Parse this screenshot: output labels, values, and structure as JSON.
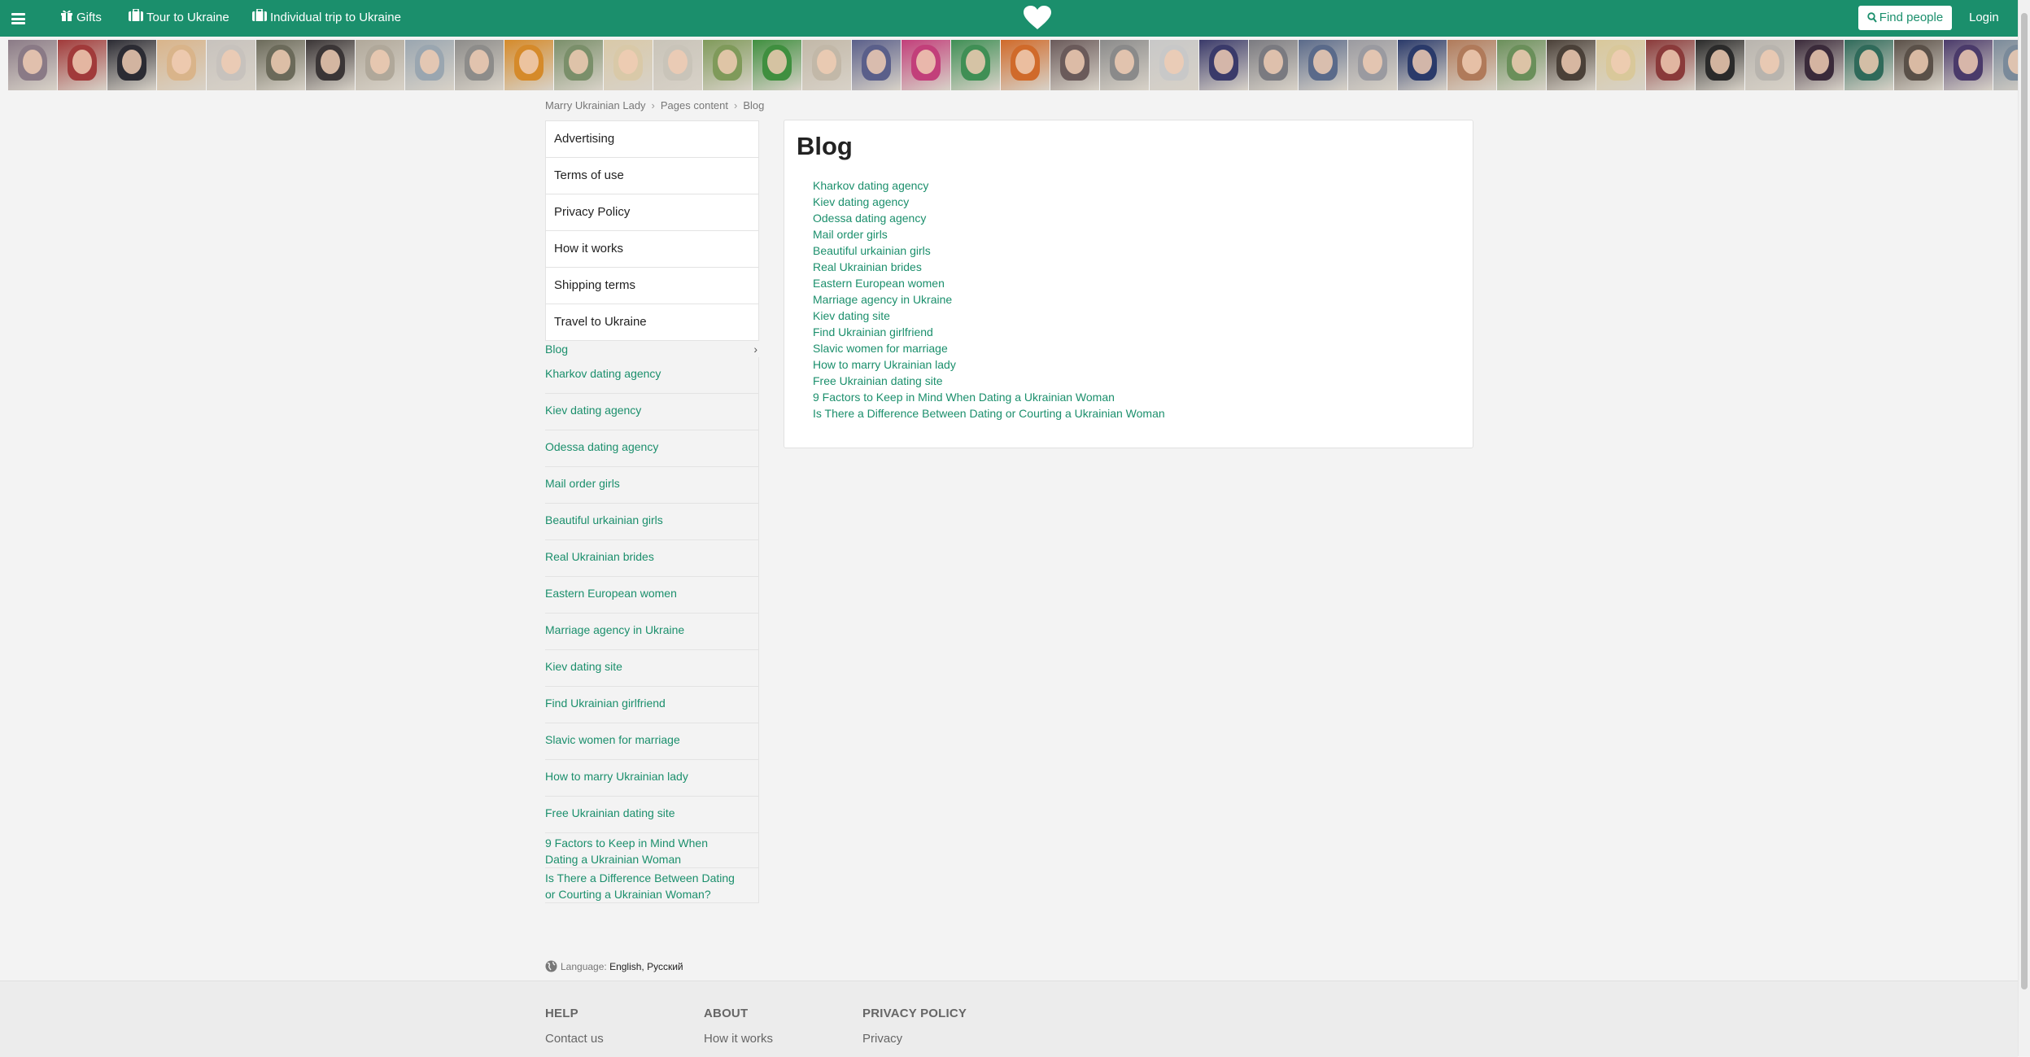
{
  "nav": {
    "gifts": "Gifts",
    "tour": "Tour to Ukraine",
    "individual_trip": "Individual trip to Ukraine",
    "find_people": "Find people",
    "login": "Login"
  },
  "photo_strip": {
    "count": 41,
    "colors": [
      "#8a7a86",
      "#a13a3a",
      "#2b2b33",
      "#d9b48a",
      "#c7c2bd",
      "#6b6a5a",
      "#3a3536",
      "#b0a89a",
      "#9aa6b0",
      "#8d8c8a",
      "#d58a2a",
      "#7a8f6a",
      "#d9c9a8",
      "#c9c4b9",
      "#7f9a5a",
      "#3f8f3f",
      "#c2b8a8",
      "#5a5f8a",
      "#c23f7a",
      "#3f8f55",
      "#d06a2a",
      "#6a5a5a",
      "#8a8a8a",
      "#c8c8c8",
      "#3a3a6a",
      "#7a7a80",
      "#5a6a8a",
      "#9a9aa0",
      "#2a3a6a",
      "#b07a5a",
      "#6a8f5a",
      "#4a4038",
      "#d9c89a",
      "#8a3a3a",
      "#2a2a2a",
      "#b8b4ae",
      "#3a2a3a",
      "#2f6a5a",
      "#5a5048",
      "#4a3a6a",
      "#7a8a9a"
    ]
  },
  "breadcrumb": [
    "Marry Ukrainian Lady",
    "Pages content",
    "Blog"
  ],
  "sidebar": {
    "boxed": [
      "Advertising",
      "Terms of use",
      "Privacy Policy",
      "How it works",
      "Shipping terms",
      "Travel to Ukraine"
    ],
    "blog_label": "Blog",
    "blog_items": [
      "Kharkov dating agency",
      "Kiev dating agency",
      "Odessa dating agency",
      "Mail order girls",
      "Beautiful urkainian girls",
      "Real Ukrainian brides",
      "Eastern European women",
      "Marriage agency in Ukraine",
      "Kiev dating site",
      "Find Ukrainian girlfriend",
      "Slavic women for marriage",
      "How to marry Ukrainian lady",
      "Free Ukrainian dating site",
      "9 Factors to Keep in Mind When Dating a Ukrainian Woman",
      "Is There a Difference Between Dating or Courting a Ukrainian Woman?"
    ]
  },
  "main": {
    "title": "Blog",
    "links": [
      "Kharkov dating agency",
      "Kiev dating agency",
      "Odessa dating agency",
      "Mail order girls",
      "Beautiful urkainian girls",
      "Real Ukrainian brides",
      "Eastern European women",
      "Marriage agency in Ukraine",
      "Kiev dating site",
      "Find Ukrainian girlfriend",
      "Slavic women for marriage",
      "How to marry Ukrainian lady",
      "Free Ukrainian dating site",
      "9 Factors to Keep in Mind When Dating a Ukrainian Woman",
      "Is There a Difference Between Dating or Courting a Ukrainian Woman"
    ]
  },
  "language": {
    "label": "Language:",
    "options": "English, Русский"
  },
  "footer": {
    "help": {
      "title": "HELP",
      "link": "Contact us"
    },
    "about": {
      "title": "ABOUT",
      "link": "How it works"
    },
    "privacy": {
      "title": "PRIVACY POLICY",
      "link": "Privacy"
    }
  },
  "colors": {
    "brand": "#1b8f6c",
    "background": "#f3f3f3"
  },
  "icons": [
    "menu-icon",
    "gift-icon",
    "suitcase-icon",
    "heart-logo-icon",
    "search-icon",
    "chevron-right-icon",
    "globe-icon"
  ]
}
